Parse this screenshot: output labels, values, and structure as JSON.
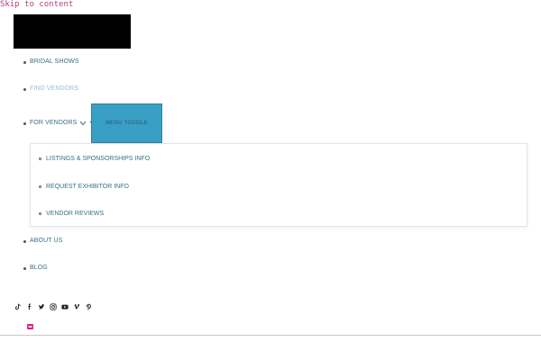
{
  "skip_link": "Skip to content",
  "nav": {
    "items": [
      {
        "label": "BRIDAL SHOWS"
      },
      {
        "label": "FIND VENDORS"
      },
      {
        "label": "FOR VENDORS"
      },
      {
        "label": "ABOUT US"
      },
      {
        "label": "BLOG"
      }
    ],
    "menu_toggle": "MENU TOGGLE",
    "submenu": [
      {
        "label": "LISTINGS & SPONSORSHIPS INFO"
      },
      {
        "label": "REQUEST EXHIBITOR INFO"
      },
      {
        "label": "VENDOR REVIEWS"
      }
    ]
  },
  "social_icons": [
    "tiktok-icon",
    "facebook-icon",
    "twitter-icon",
    "instagram-icon",
    "youtube-icon",
    "vimeo-icon",
    "pinterest-icon"
  ],
  "colors": {
    "link": "#3a6f86",
    "toggle_bg": "#3a9fc4",
    "skip_link": "#b0407a",
    "badge": "#e0207f"
  }
}
